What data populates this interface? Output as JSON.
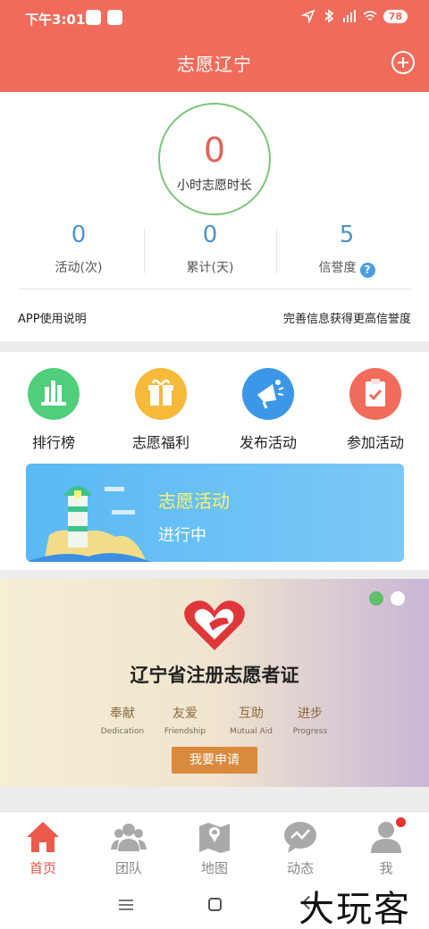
{
  "status_bar": {
    "time": "下午3:01",
    "battery": "78"
  },
  "header": {
    "title": "志愿辽宁"
  },
  "summary": {
    "hours_value": "0",
    "hours_label": "小时志愿时长"
  },
  "stats": [
    {
      "value": "0",
      "label": "活动(次)"
    },
    {
      "value": "0",
      "label": "累计(天)"
    },
    {
      "value": "5",
      "label": "信誉度"
    }
  ],
  "help_glyph": "?",
  "links": {
    "left": "APP使用说明",
    "right": "完善信息获得更高信誉度"
  },
  "features": [
    {
      "label": "排行榜",
      "icon": "ranking-icon",
      "color": "#4fcf7c"
    },
    {
      "label": "志愿福利",
      "icon": "gift-icon",
      "color": "#f6b93a"
    },
    {
      "label": "发布活动",
      "icon": "megaphone-icon",
      "color": "#3d97e8"
    },
    {
      "label": "参加活动",
      "icon": "clipboard-icon",
      "color": "#f26c5b"
    }
  ],
  "activity_banner": {
    "title": "志愿活动",
    "subtitle": "进行中"
  },
  "certificate": {
    "title": "辽宁省注册志愿者证",
    "values": [
      {
        "cn": "奉献",
        "en": "Dedication"
      },
      {
        "cn": "友爱",
        "en": "Friendship"
      },
      {
        "cn": "互助",
        "en": "Mutual Aid"
      },
      {
        "cn": "进步",
        "en": "Progress"
      }
    ],
    "button": "我要申请",
    "carousel_active": 1,
    "carousel_count": 2
  },
  "tabs": [
    {
      "label": "首页",
      "icon": "home-icon",
      "active": true
    },
    {
      "label": "团队",
      "icon": "team-icon",
      "active": false
    },
    {
      "label": "地图",
      "icon": "map-icon",
      "active": false
    },
    {
      "label": "动态",
      "icon": "news-icon",
      "active": false
    },
    {
      "label": "我",
      "icon": "profile-icon",
      "active": false,
      "badge": true
    }
  ],
  "watermark": "大玩客",
  "colors": {
    "header": "#f16b5b",
    "accent_red": "#e0554a",
    "stat_blue": "#4b93d1",
    "circle_green": "#7cc67a",
    "apply_button": "#d98a3c"
  }
}
